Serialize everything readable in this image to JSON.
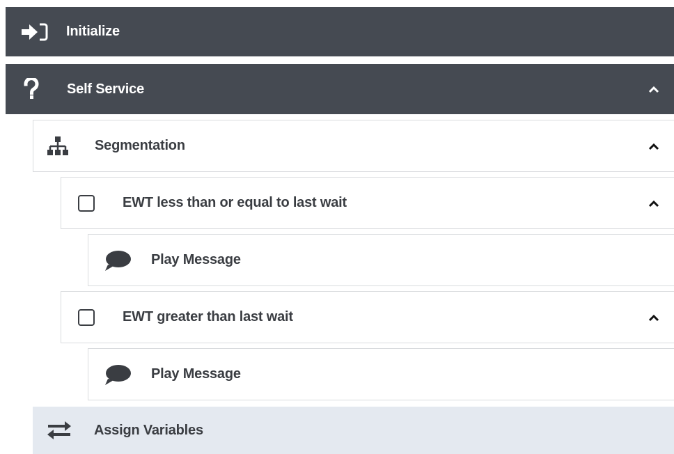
{
  "tree": {
    "initialize": {
      "label": "Initialize",
      "icon": "sign-in-icon"
    },
    "self_service": {
      "label": "Self Service",
      "icon": "question-icon",
      "expanded": true
    },
    "segmentation": {
      "label": "Segmentation",
      "icon": "sitemap-icon",
      "expanded": true
    },
    "branch1": {
      "label": "EWT less than or equal to last wait",
      "icon": "checkbox-icon",
      "checked": false,
      "expanded": true
    },
    "branch1_play": {
      "label": "Play Message",
      "icon": "speech-bubble-icon"
    },
    "branch2": {
      "label": "EWT greater than last wait",
      "icon": "checkbox-icon",
      "checked": false,
      "expanded": true
    },
    "branch2_play": {
      "label": "Play Message",
      "icon": "speech-bubble-icon"
    },
    "assign_variables": {
      "label": "Assign Variables",
      "icon": "exchange-arrows-icon"
    }
  },
  "colors": {
    "dark_row": "#454a52",
    "border": "#d9dbde",
    "highlight_row": "#e4e9f0",
    "text_dark": "#3a3d42"
  }
}
